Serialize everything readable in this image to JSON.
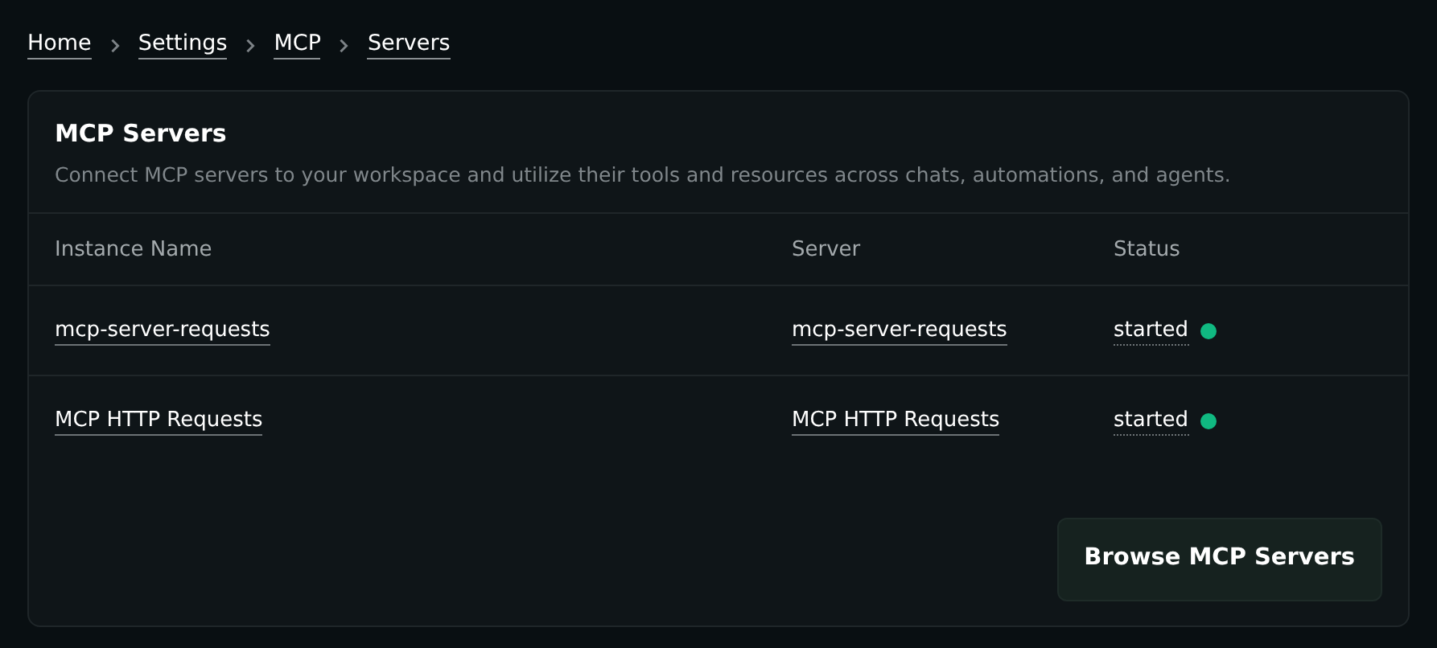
{
  "breadcrumb": [
    "Home",
    "Settings",
    "MCP",
    "Servers"
  ],
  "card": {
    "title": "MCP Servers",
    "description": "Connect MCP servers to your workspace and utilize their tools and resources across chats, automations, and agents."
  },
  "table": {
    "columns": [
      "Instance Name",
      "Server",
      "Status"
    ],
    "rows": [
      {
        "instance": "mcp-server-requests",
        "server": "mcp-server-requests",
        "status": "started",
        "color": "#10b981"
      },
      {
        "instance": "MCP HTTP Requests",
        "server": "MCP HTTP Requests",
        "status": "started",
        "color": "#10b981"
      }
    ]
  },
  "button": "Browse MCP Servers"
}
